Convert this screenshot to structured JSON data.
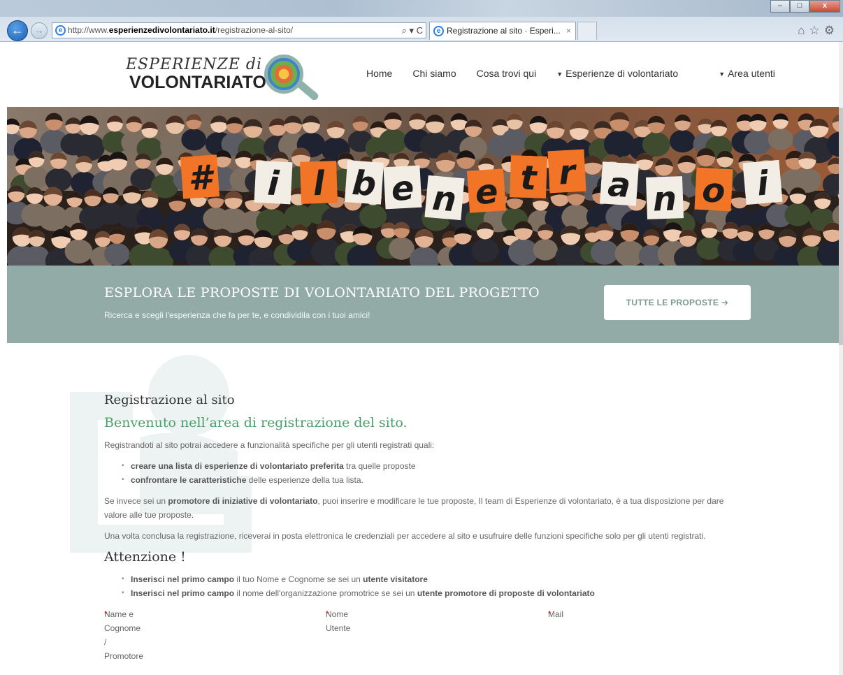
{
  "browser": {
    "url_prefix": "http://www.",
    "url_domain": "esperienzedivolontariato.it",
    "url_path": "/registrazione-al-sito/",
    "address_tools": "⌕ ▾ C",
    "tab_title": "Registrazione al sito · Esperi...",
    "tab_close": "×",
    "window_min": "–",
    "window_max": "□",
    "window_close": "x"
  },
  "header": {
    "logo_line1": "ESPERIENZE di",
    "logo_line2": "VOLONTARIATO",
    "nav": [
      {
        "label": "Home"
      },
      {
        "label": "Chi siamo"
      },
      {
        "label": "Cosa trovi qui"
      },
      {
        "label": "Esperienze di volontariato",
        "dropdown": true
      },
      {
        "label": "Area utenti",
        "dropdown": true
      }
    ]
  },
  "hero": {
    "letters": [
      "#",
      "i",
      "l",
      "b",
      "e",
      "n",
      "e",
      "t",
      "r",
      "a",
      "n",
      "o",
      "i"
    ]
  },
  "cta": {
    "title": "ESPLORA LE PROPOSTE DI VOLONTARIATO DEL PROGETTO",
    "subtitle": "Ricerca e scegli l'esperienza che fa per te, e condividila con i tuoi amici!",
    "button": "TUTTE LE PROPOSTE ➔"
  },
  "content": {
    "heading": "Registrazione al sito",
    "welcome": "Benvenuto nell’area di registrazione del sito.",
    "intro": "Registrandoti al sito potrai accedere a funzionalità specifiche per gli utenti registrati quali:",
    "bullets1": [
      {
        "bold": "creare una lista di esperienze di volontariato preferita",
        "rest": " tra quelle proposte"
      },
      {
        "bold": "confrontare le caratteristiche",
        "rest": " delle esperienze della tua lista."
      }
    ],
    "promoter_pre": "Se invece sei un ",
    "promoter_bold": "promotore di iniziative di volontariato",
    "promoter_post": ", puoi inserire e modificare le tue proposte, Il team di Esperienze di volontariato, è a tua disposizione per dare valore alle tue proposte.",
    "completion": "Una volta conclusa la registrazione, riceverai in posta elettronica le credenziali per accedere al sito e usufruire delle funzioni specifiche solo per gli utenti registrati.",
    "attention": "Attenzione !",
    "bullets2": [
      {
        "bold1": "Inserisci nel primo campo",
        "mid": " il tuo Nome e Cognome se sei un ",
        "bold2": "utente visitatore"
      },
      {
        "bold1": "Inserisci nel primo campo",
        "mid": " il nome dell'organizzazione promotrice se sei un ",
        "bold2": "utente promotore di proposte di volontariato"
      }
    ],
    "form_labels": [
      {
        "label": "Name e Cognome / Promotore"
      },
      {
        "label": "Nome Utente "
      },
      {
        "label": "Mail "
      }
    ],
    "required_mark": "*"
  }
}
